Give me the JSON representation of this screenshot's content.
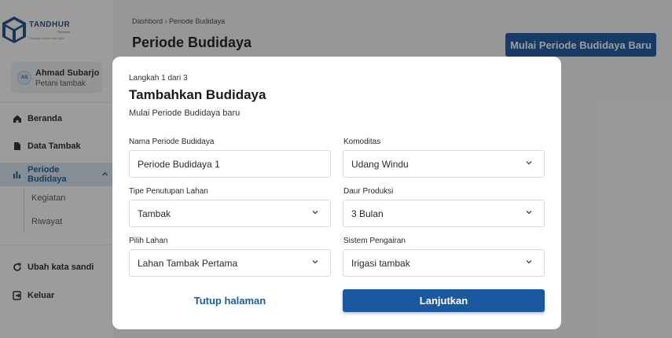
{
  "brand": {
    "name": "TANDHUR",
    "sub": "Fisheries",
    "tagline": "Cultivate better with Data"
  },
  "profile": {
    "initials": "AS",
    "name": "Ahmad Subarjo",
    "role": "Petani tambak"
  },
  "sidebar": {
    "items": [
      {
        "label": "Beranda",
        "icon": "home-icon"
      },
      {
        "label": "Data Tambak",
        "icon": "document-icon"
      },
      {
        "label": "Periode Budidaya",
        "icon": "bar-chart-icon",
        "active": true
      }
    ],
    "subitems": [
      "Kegiatan",
      "Riwayat"
    ],
    "bottom": [
      {
        "label": "Ubah kata sandi",
        "icon": "refresh-icon"
      },
      {
        "label": "Keluar",
        "icon": "logout-icon"
      }
    ]
  },
  "header": {
    "breadcrumb": "Dashbord  ›  Periode Budidaya",
    "title": "Periode Budidaya",
    "action_label": "Mulai Periode Budidaya Baru"
  },
  "modal": {
    "step": "Langkah 1 dari 3",
    "title": "Tambahkan Budidaya",
    "subtitle": "Mulai Periode Budidaya baru",
    "fields": {
      "nama": {
        "label": "Nama Periode Budidaya",
        "value": "Periode Budidaya 1"
      },
      "komoditas": {
        "label": "Komoditas",
        "value": "Udang Windu"
      },
      "tipe": {
        "label": "Tipe Penutupan Lahan",
        "value": "Tambak"
      },
      "daur": {
        "label": "Daur Produksi",
        "value": "3 Bulan"
      },
      "lahan": {
        "label": "Pilih Lahan",
        "value": "Lahan Tambak Pertama"
      },
      "sistem": {
        "label": "Sistem Pengairan",
        "value": "Irigasi tambak"
      }
    },
    "close_label": "Tutup halaman",
    "next_label": "Lanjutkan"
  },
  "colors": {
    "primary": "#1a58a0",
    "active_bg": "#dbe5f1",
    "overlay": "#000000"
  }
}
